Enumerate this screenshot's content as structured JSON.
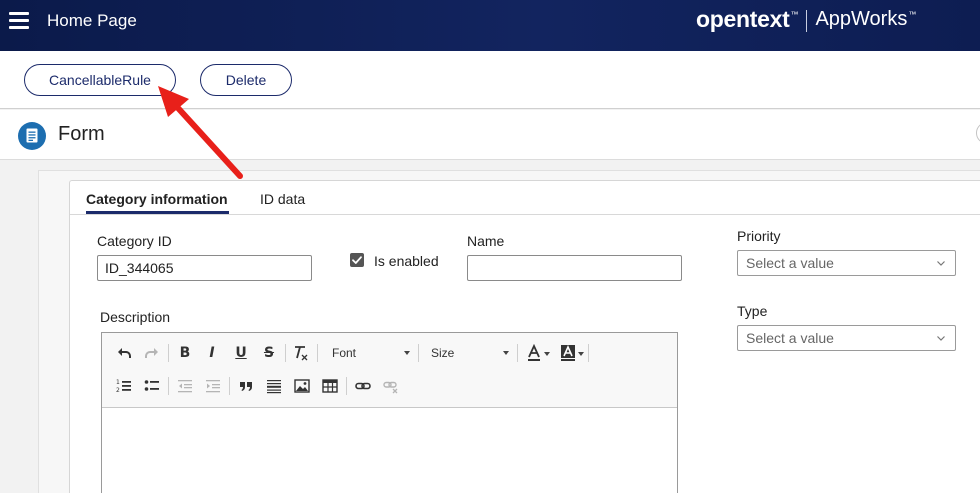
{
  "header": {
    "menu_icon": "hamburger-menu-icon",
    "title": "Home Page",
    "brand_name": "opentext",
    "brand_tm": "™",
    "product_name": "AppWorks",
    "product_tm": "™"
  },
  "toolbar": {
    "cancellable_rule_label": "CancellableRule",
    "delete_label": "Delete"
  },
  "form": {
    "icon": "form-document-icon",
    "title": "Form"
  },
  "tabs": [
    {
      "label": "Category information",
      "active": true
    },
    {
      "label": "ID data",
      "active": false
    }
  ],
  "fields": {
    "category_id_label": "Category ID",
    "category_id_value": "ID_344065",
    "is_enabled_label": "Is enabled",
    "is_enabled_checked": true,
    "name_label": "Name",
    "name_value": "",
    "priority_label": "Priority",
    "priority_placeholder": "Select a value",
    "type_label": "Type",
    "type_placeholder": "Select a value",
    "description_label": "Description"
  },
  "editor": {
    "font_label": "Font",
    "size_label": "Size",
    "buttons": [
      "undo-icon",
      "redo-icon",
      "bold-icon",
      "italic-icon",
      "underline-icon",
      "strikethrough-icon",
      "remove-format-icon",
      "text-color-icon",
      "background-color-icon",
      "numbered-list-icon",
      "bulleted-list-icon",
      "decrease-indent-icon",
      "increase-indent-icon",
      "blockquote-icon",
      "horizontal-line-icon",
      "image-icon",
      "table-icon",
      "link-icon",
      "unlink-icon"
    ]
  },
  "colors": {
    "header_bg": "#0b1a4a",
    "accent": "#1c2b6b",
    "form_icon": "#1d6eb0",
    "annotation_arrow": "#e8201a"
  }
}
